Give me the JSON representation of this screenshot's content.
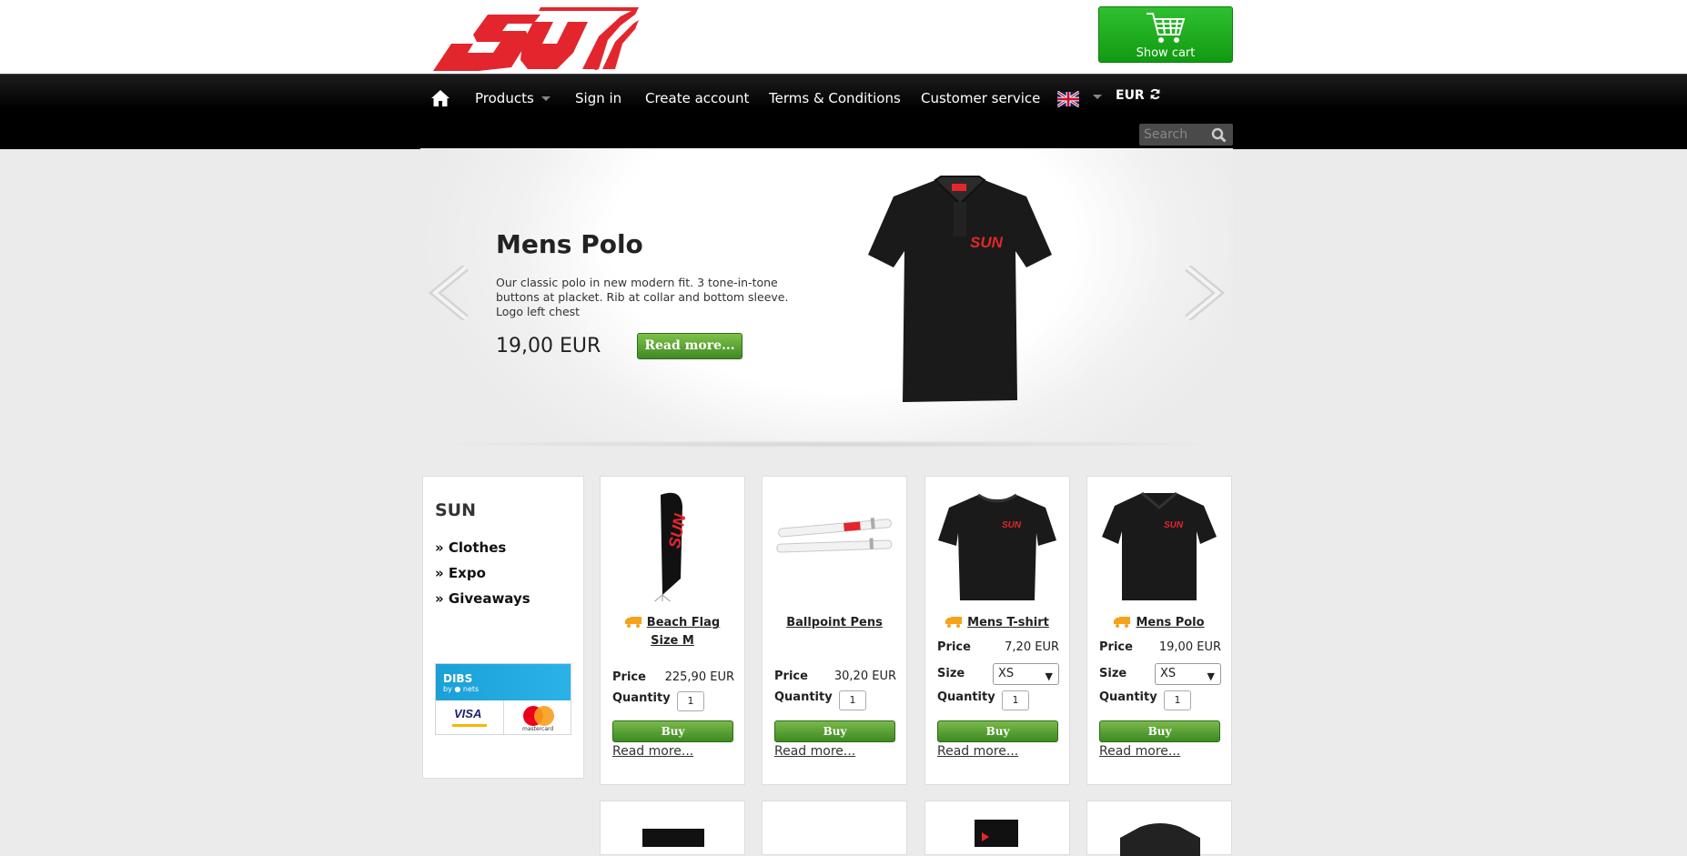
{
  "header": {
    "logo_alt": "SUN",
    "cart_label": "Show cart"
  },
  "nav": {
    "products": "Products",
    "sign_in": "Sign in",
    "create_account": "Create account",
    "terms": "Terms & Conditions",
    "customer_service": "Customer service",
    "currency": "EUR",
    "search_placeholder": "Search"
  },
  "hero": {
    "title": "Mens Polo",
    "description": "Our classic polo in new modern fit. 3 tone-in-tone buttons at placket. Rib at collar and bottom sleeve. Logo left chest",
    "price": "19,00 EUR",
    "read_more": "Read more..."
  },
  "sidebar": {
    "title": "SUN",
    "links": [
      "» Clothes",
      "» Expo",
      "» Giveaways"
    ],
    "dibs_title": "DIBS",
    "dibs_sub": "by ● nets",
    "visa": "VISA",
    "mastercard": "mastercard"
  },
  "labels": {
    "price": "Price",
    "size": "Size",
    "quantity": "Quantity",
    "buy": "Buy",
    "read_more": "Read more..."
  },
  "products": [
    {
      "name": "Beach Flag Size M",
      "price": "225,90 EUR",
      "quantity": "1",
      "truck": true
    },
    {
      "name": "Ballpoint Pens",
      "price": "30,20 EUR",
      "quantity": "1",
      "truck": false
    },
    {
      "name": "Mens T-shirt",
      "price": "7,20 EUR",
      "size": "XS",
      "quantity": "1",
      "truck": true
    },
    {
      "name": "Mens Polo",
      "price": "19,00 EUR",
      "size": "XS",
      "quantity": "1",
      "truck": true
    }
  ],
  "colors": {
    "brand_red": "#e3262d",
    "buy_green": "#4a9a2c",
    "cart_green": "#1fab1f",
    "truck_orange": "#f5a31a"
  }
}
